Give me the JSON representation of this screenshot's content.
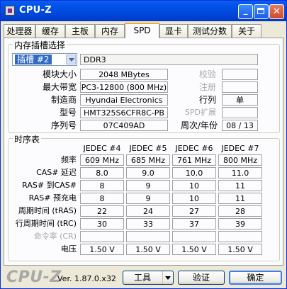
{
  "window": {
    "title": "CPU-Z",
    "minimize_glyph": "_",
    "close_glyph": "✕"
  },
  "tabs": [
    {
      "label": "处理器",
      "active": false
    },
    {
      "label": "缓存",
      "active": false
    },
    {
      "label": "主板",
      "active": false
    },
    {
      "label": "内存",
      "active": false
    },
    {
      "label": "SPD",
      "active": true
    },
    {
      "label": "显卡",
      "active": false
    },
    {
      "label": "测试分数",
      "active": false
    },
    {
      "label": "关于",
      "active": false
    }
  ],
  "slot_group": {
    "title": "内存插槽选择",
    "slot_select": "插槽 #2",
    "memory_type": "DDR3",
    "rows": [
      {
        "label": "模块大小",
        "value": "2048 MBytes",
        "right_label": "校验",
        "right_value": ""
      },
      {
        "label": "最大带宽",
        "value": "PC3-12800 (800 MHz)",
        "right_label": "注册",
        "right_value": ""
      },
      {
        "label": "制造商",
        "value": "Hyundai Electronics",
        "right_label": "行列",
        "right_value": "单"
      },
      {
        "label": "型号",
        "value": "HMT325S6CFR8C-PB",
        "right_label": "SPD扩展",
        "right_value": ""
      },
      {
        "label": "序列号",
        "value": "07C409AD",
        "right_label": "周次/年份",
        "right_value": "08 / 13"
      }
    ]
  },
  "timing_group": {
    "title": "时序表",
    "columns": [
      "JEDEC #4",
      "JEDEC #5",
      "JEDEC #6",
      "JEDEC #7"
    ],
    "rows": [
      {
        "label": "频率",
        "values": [
          "609 MHz",
          "685 MHz",
          "761 MHz",
          "800 MHz"
        ],
        "dim": false
      },
      {
        "label": "CAS# 延迟",
        "values": [
          "8.0",
          "9.0",
          "10.0",
          "11.0"
        ],
        "dim": false
      },
      {
        "label": "RAS# 到CAS#",
        "values": [
          "8",
          "9",
          "10",
          "11"
        ],
        "dim": false
      },
      {
        "label": "RAS# 预充电",
        "values": [
          "8",
          "9",
          "10",
          "11"
        ],
        "dim": false
      },
      {
        "label": "周期时间 (tRAS)",
        "values": [
          "22",
          "24",
          "27",
          "28"
        ],
        "dim": false
      },
      {
        "label": "行周期时间 (tRC)",
        "values": [
          "30",
          "33",
          "37",
          "39"
        ],
        "dim": false
      },
      {
        "label": "命令率 (CR)",
        "values": [
          "",
          "",
          "",
          ""
        ],
        "dim": true
      },
      {
        "label": "电压",
        "values": [
          "1.50 V",
          "1.50 V",
          "1.50 V",
          "1.50 V"
        ],
        "dim": false
      }
    ]
  },
  "footer": {
    "logo": "CPU-Z",
    "version": "Ver. 1.87.0.x32",
    "tools_label": "工具",
    "validate_label": "验证",
    "ok_label": "确定"
  }
}
